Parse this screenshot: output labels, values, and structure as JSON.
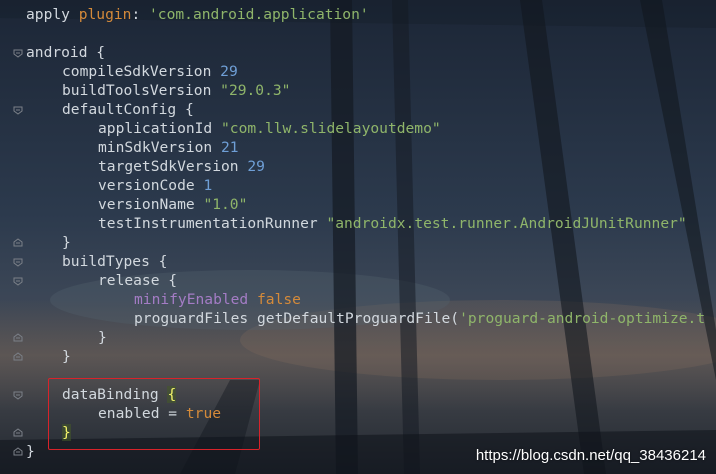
{
  "editor": {
    "lines": [
      {
        "tokens": [
          {
            "t": "apply ",
            "c": ""
          },
          {
            "t": "plugin",
            "c": "kw"
          },
          {
            "t": ": ",
            "c": ""
          },
          {
            "t": "'com.android.application'",
            "c": "str"
          }
        ]
      },
      {
        "tokens": []
      },
      {
        "tokens": [
          {
            "t": "android {",
            "c": ""
          }
        ]
      },
      {
        "tokens": [
          {
            "t": "compileSdkVersion ",
            "c": ""
          },
          {
            "t": "29",
            "c": "num"
          }
        ]
      },
      {
        "tokens": [
          {
            "t": "buildToolsVersion ",
            "c": ""
          },
          {
            "t": "\"29.0.3\"",
            "c": "str"
          }
        ]
      },
      {
        "tokens": [
          {
            "t": "defaultConfig {",
            "c": ""
          }
        ]
      },
      {
        "tokens": [
          {
            "t": "applicationId ",
            "c": ""
          },
          {
            "t": "\"com.llw.slidelayoutdemo\"",
            "c": "str"
          }
        ]
      },
      {
        "tokens": [
          {
            "t": "minSdkVersion ",
            "c": ""
          },
          {
            "t": "21",
            "c": "num"
          }
        ]
      },
      {
        "tokens": [
          {
            "t": "targetSdkVersion ",
            "c": ""
          },
          {
            "t": "29",
            "c": "num"
          }
        ]
      },
      {
        "tokens": [
          {
            "t": "versionCode ",
            "c": ""
          },
          {
            "t": "1",
            "c": "num"
          }
        ]
      },
      {
        "tokens": [
          {
            "t": "versionName ",
            "c": ""
          },
          {
            "t": "\"1.0\"",
            "c": "str"
          }
        ]
      },
      {
        "tokens": [
          {
            "t": "testInstrumentationRunner ",
            "c": ""
          },
          {
            "t": "\"androidx.test.runner.AndroidJUnitRunner\"",
            "c": "str"
          }
        ]
      },
      {
        "tokens": [
          {
            "t": "}",
            "c": ""
          }
        ]
      },
      {
        "tokens": [
          {
            "t": "buildTypes {",
            "c": ""
          }
        ]
      },
      {
        "tokens": [
          {
            "t": "release {",
            "c": ""
          }
        ]
      },
      {
        "tokens": [
          {
            "t": "minifyEnabled ",
            "c": "prop"
          },
          {
            "t": "false",
            "c": "kw"
          }
        ]
      },
      {
        "tokens": [
          {
            "t": "proguardFiles getDefaultProguardFile(",
            "c": ""
          },
          {
            "t": "'proguard-android-optimize.t",
            "c": "str"
          }
        ]
      },
      {
        "tokens": [
          {
            "t": "}",
            "c": ""
          }
        ]
      },
      {
        "tokens": [
          {
            "t": "}",
            "c": ""
          }
        ]
      },
      {
        "tokens": []
      },
      {
        "tokens": [
          {
            "t": "dataBinding ",
            "c": ""
          },
          {
            "t": "{",
            "c": "brace-hl"
          }
        ]
      },
      {
        "tokens": [
          {
            "t": "enabled = ",
            "c": ""
          },
          {
            "t": "true",
            "c": "kw"
          }
        ]
      },
      {
        "tokens": [
          {
            "t": "}",
            "c": "brace-hl"
          }
        ]
      },
      {
        "tokens": [
          {
            "t": "}",
            "c": ""
          }
        ]
      }
    ],
    "indents": [
      0,
      0,
      0,
      1,
      1,
      1,
      2,
      2,
      2,
      2,
      2,
      2,
      1,
      1,
      2,
      3,
      3,
      2,
      1,
      0,
      1,
      2,
      1,
      0
    ]
  },
  "watermark": "https://blog.csdn.net/qq_38436214",
  "colors": {
    "string": "#8fb56a",
    "number": "#6f9fd6",
    "keyword": "#d48a3a",
    "property": "#a47cc5",
    "highlight_box": "#d8232a"
  }
}
